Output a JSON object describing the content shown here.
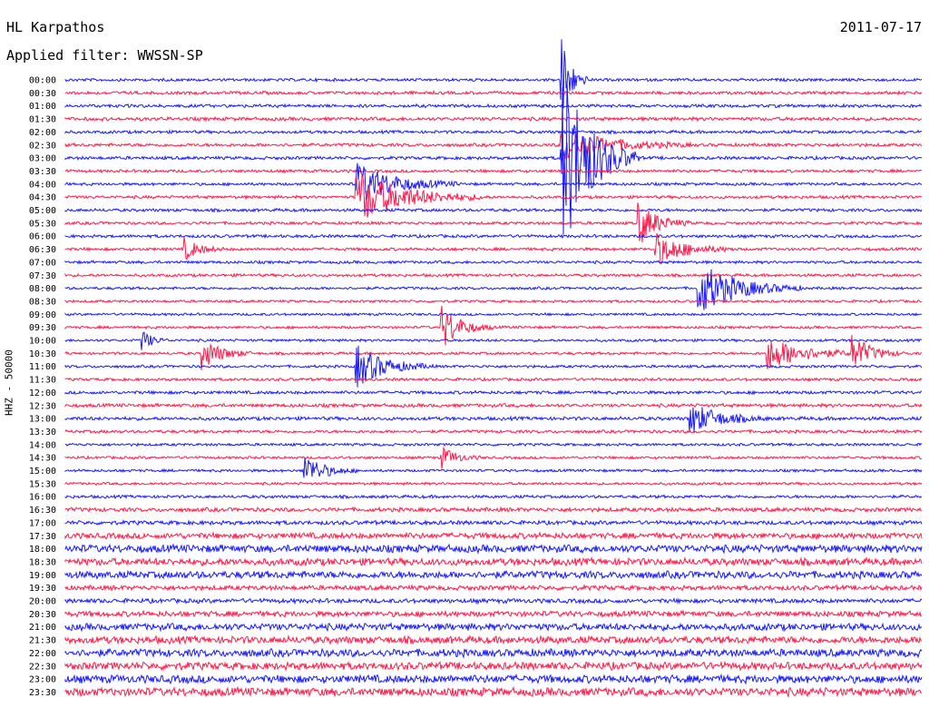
{
  "header": {
    "station": "HL Karpathos",
    "date": "2011-07-17",
    "filter": "Applied filter: WWSSN-SP",
    "channel_label": "HHZ - 50000"
  },
  "colors": {
    "odd": "#1a1aff",
    "even": "#ff1a4a",
    "text": "#000000"
  },
  "chart_data": {
    "type": "line",
    "title": "HL Karpathos",
    "ylabel": "HHZ - 50000",
    "rows": [
      "00:00",
      "00:30",
      "01:00",
      "01:30",
      "02:00",
      "02:30",
      "03:00",
      "03:30",
      "04:00",
      "04:30",
      "05:00",
      "05:30",
      "06:00",
      "06:30",
      "07:00",
      "07:30",
      "08:00",
      "08:30",
      "09:00",
      "09:30",
      "10:00",
      "10:30",
      "11:00",
      "11:30",
      "12:00",
      "12:30",
      "13:00",
      "13:30",
      "14:00",
      "14:30",
      "15:00",
      "15:30",
      "16:00",
      "16:30",
      "17:00",
      "17:30",
      "18:00",
      "18:30",
      "19:00",
      "19:30",
      "20:00",
      "20:30",
      "21:00",
      "21:30",
      "22:00",
      "22:30",
      "23:00",
      "23:30"
    ],
    "noise_level": [
      0.25,
      0.35,
      0.35,
      0.45,
      0.3,
      0.35,
      0.35,
      0.3,
      0.25,
      0.3,
      0.3,
      0.25,
      0.3,
      0.3,
      0.25,
      0.25,
      0.2,
      0.15,
      0.15,
      0.2,
      0.2,
      0.2,
      0.2,
      0.25,
      0.35,
      0.45,
      0.45,
      0.3,
      0.2,
      0.2,
      0.2,
      0.2,
      0.3,
      0.6,
      0.6,
      1.1,
      1.6,
      1.5,
      1.5,
      0.8,
      0.7,
      1.0,
      1.4,
      1.5,
      1.6,
      1.6,
      1.7,
      1.8
    ],
    "events": [
      {
        "row": 0,
        "x": 0.58,
        "amp": 8,
        "dur": 0.01
      },
      {
        "row": 5,
        "x": 0.58,
        "amp": 3,
        "dur": 0.05
      },
      {
        "row": 6,
        "x": 0.58,
        "amp": 18,
        "dur": 0.03
      },
      {
        "row": 8,
        "x": 0.34,
        "amp": 4,
        "dur": 0.04
      },
      {
        "row": 9,
        "x": 0.34,
        "amp": 5,
        "dur": 0.05
      },
      {
        "row": 11,
        "x": 0.67,
        "amp": 4,
        "dur": 0.02
      },
      {
        "row": 13,
        "x": 0.14,
        "amp": 2,
        "dur": 0.015
      },
      {
        "row": 13,
        "x": 0.69,
        "amp": 3,
        "dur": 0.03
      },
      {
        "row": 16,
        "x": 0.74,
        "amp": 5,
        "dur": 0.04
      },
      {
        "row": 19,
        "x": 0.44,
        "amp": 4,
        "dur": 0.02
      },
      {
        "row": 20,
        "x": 0.09,
        "amp": 2,
        "dur": 0.01
      },
      {
        "row": 21,
        "x": 0.16,
        "amp": 3,
        "dur": 0.02
      },
      {
        "row": 21,
        "x": 0.82,
        "amp": 3,
        "dur": 0.04
      },
      {
        "row": 21,
        "x": 0.92,
        "amp": 3,
        "dur": 0.02
      },
      {
        "row": 22,
        "x": 0.34,
        "amp": 4,
        "dur": 0.03
      },
      {
        "row": 26,
        "x": 0.73,
        "amp": 3,
        "dur": 0.03
      },
      {
        "row": 29,
        "x": 0.44,
        "amp": 2,
        "dur": 0.015
      },
      {
        "row": 30,
        "x": 0.28,
        "amp": 3,
        "dur": 0.02
      }
    ]
  }
}
